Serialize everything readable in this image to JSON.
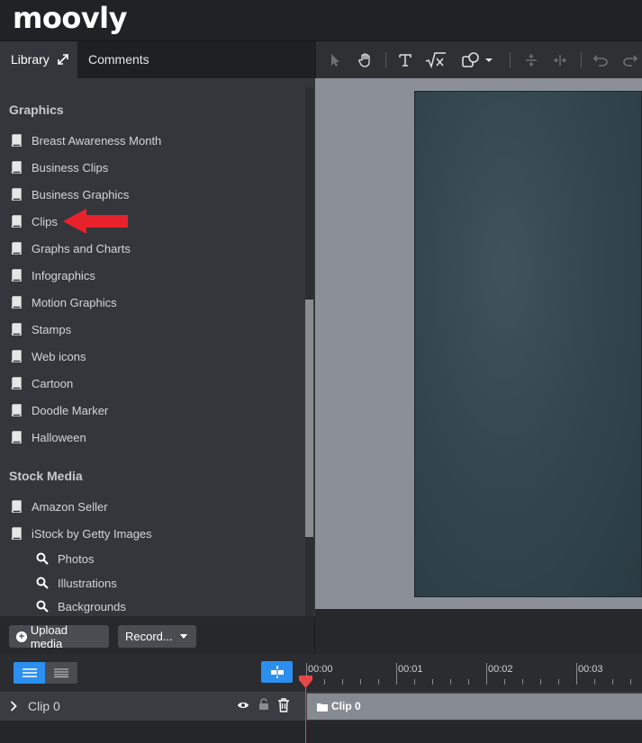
{
  "app": {
    "logo": "moovly"
  },
  "panel": {
    "tabs": {
      "library": "Library",
      "comments": "Comments"
    }
  },
  "library": {
    "graphics_title": "Graphics",
    "graphics_items": [
      "Breast Awareness Month",
      "Business Clips",
      "Business Graphics",
      "Clips",
      "Graphs and Charts",
      "Infographics",
      "Motion Graphics",
      "Stamps",
      "Web icons",
      "Cartoon",
      "Doodle Marker",
      "Halloween"
    ],
    "stock_title": "Stock Media",
    "stock_items": [
      "Amazon Seller",
      "iStock by Getty Images"
    ],
    "istock_sub": [
      "Photos",
      "Illustrations",
      "Backgrounds"
    ]
  },
  "bottom": {
    "upload": "Upload media",
    "record": "Record..."
  },
  "timeline": {
    "ticks": [
      "00:00",
      "00:01",
      "00:02",
      "00:03"
    ],
    "track_name": "Clip 0",
    "clip_label": "Clip 0"
  },
  "colors": {
    "accent": "#2b8ff0",
    "playhead": "#e8474a",
    "annotation_arrow": "#e8222a"
  }
}
